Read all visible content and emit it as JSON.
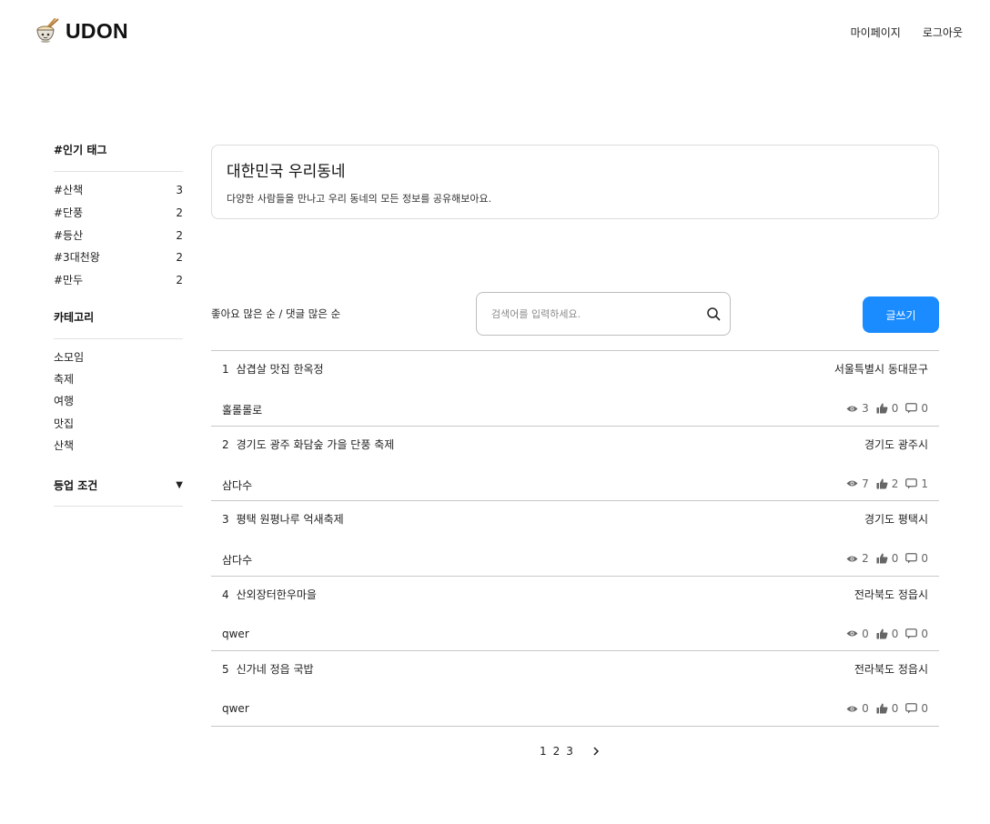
{
  "header": {
    "brand": "UDON",
    "nav": [
      "마이페이지",
      "로그아웃"
    ]
  },
  "sidebar": {
    "tags_title": "#인기 태그",
    "tags": [
      {
        "name": "#산책",
        "count": "3"
      },
      {
        "name": "#단풍",
        "count": "2"
      },
      {
        "name": "#등산",
        "count": "2"
      },
      {
        "name": "#3대천왕",
        "count": "2"
      },
      {
        "name": "#만두",
        "count": "2"
      }
    ],
    "category_title": "카테고리",
    "categories": [
      "소모임",
      "축제",
      "여행",
      "맛집",
      "산책"
    ],
    "grade_title": "등업 조건",
    "grade_arrow": "▼"
  },
  "banner": {
    "title": "대한민국 우리동네",
    "description": "다양한 사람들을 만나고 우리 동네의 모든 정보를 공유해보아요."
  },
  "toolbar": {
    "sort_text": "좋아요 많은 순 / 댓글 많은 순",
    "search_placeholder": "검색어를 입력하세요.",
    "write_label": "글쓰기"
  },
  "posts": [
    {
      "num": "1",
      "title": "삼겹살 맛집 한옥정",
      "location": "서울특별시 동대문구",
      "author": "홀롤롤로",
      "views": "3",
      "likes": "0",
      "comments": "0"
    },
    {
      "num": "2",
      "title": "경기도 광주 화담숲 가을 단풍 축제",
      "location": "경기도 광주시",
      "author": "삼다수",
      "views": "7",
      "likes": "2",
      "comments": "1"
    },
    {
      "num": "3",
      "title": "평택 원평나루 억새축제",
      "location": "경기도 평택시",
      "author": "삼다수",
      "views": "2",
      "likes": "0",
      "comments": "0"
    },
    {
      "num": "4",
      "title": "산외장터한우마을",
      "location": "전라북도 정읍시",
      "author": "qwer",
      "views": "0",
      "likes": "0",
      "comments": "0"
    },
    {
      "num": "5",
      "title": "신가네 정읍 국밥",
      "location": "전라북도 정읍시",
      "author": "qwer",
      "views": "0",
      "likes": "0",
      "comments": "0"
    }
  ],
  "pagination": {
    "pages": [
      "1",
      "2",
      "3"
    ],
    "next": "›"
  },
  "icons": {
    "views": "eye-icon",
    "likes": "thumbs-up-icon",
    "comments": "comment-icon",
    "search": "search-icon",
    "logo": "udon-bowl-icon"
  },
  "colors": {
    "accent": "#1a8cff"
  }
}
